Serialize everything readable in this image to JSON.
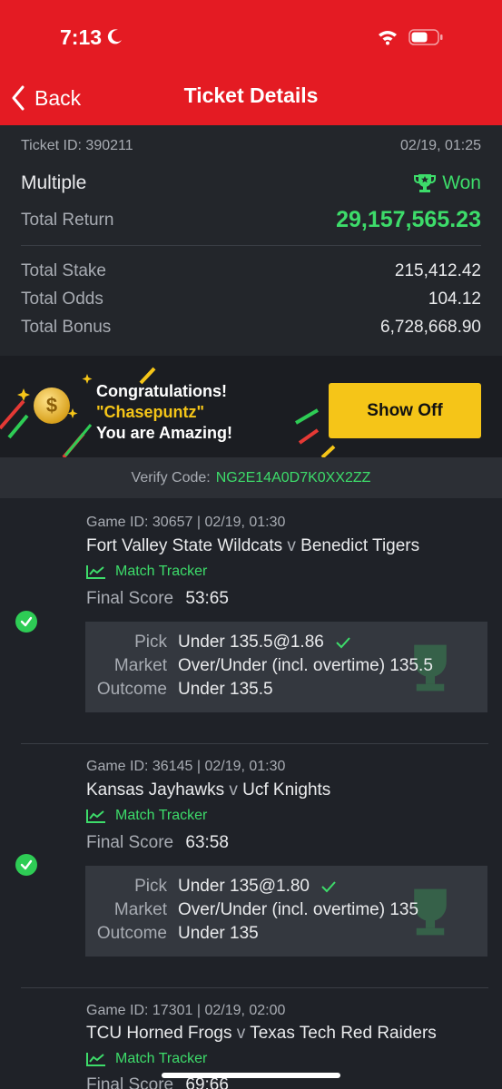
{
  "status": {
    "time": "7:13"
  },
  "header": {
    "back_label": "Back",
    "title": "Ticket Details"
  },
  "ticket": {
    "id_label": "Ticket ID: 390211",
    "datetime": "02/19, 01:25",
    "type": "Multiple",
    "status": "Won",
    "total_return_label": "Total Return",
    "total_return": "29,157,565.23",
    "total_stake_label": "Total Stake",
    "total_stake": "215,412.42",
    "total_odds_label": "Total Odds",
    "total_odds": "104.12",
    "total_bonus_label": "Total Bonus",
    "total_bonus": "6,728,668.90"
  },
  "banner": {
    "line1": "Congratulations!",
    "username": "\"Chasepuntz\"",
    "line3": "You are Amazing!",
    "button": "Show Off"
  },
  "verify": {
    "label": "Verify Code:",
    "code": "NG2E14A0D7K0XX2ZZ"
  },
  "selections": [
    {
      "game_id": "Game ID: 30657 | 02/19, 01:30",
      "home": "Fort Valley State Wildcats",
      "vs": "v",
      "away": "Benedict Tigers",
      "tracker": "Match Tracker",
      "final_label": "Final Score",
      "final_score": "53:65",
      "pick_label": "Pick",
      "pick": "Under 135.5@1.86",
      "market_label": "Market",
      "market": "Over/Under (incl. overtime) 135.5",
      "outcome_label": "Outcome",
      "outcome": "Under 135.5"
    },
    {
      "game_id": "Game ID: 36145 | 02/19, 01:30",
      "home": "Kansas Jayhawks",
      "vs": "v",
      "away": "Ucf Knights",
      "tracker": "Match Tracker",
      "final_label": "Final Score",
      "final_score": "63:58",
      "pick_label": "Pick",
      "pick": "Under 135@1.80",
      "market_label": "Market",
      "market": "Over/Under (incl. overtime) 135",
      "outcome_label": "Outcome",
      "outcome": "Under 135"
    },
    {
      "game_id": "Game ID: 17301 | 02/19, 02:00",
      "home": "TCU Horned Frogs",
      "vs": "v",
      "away": "Texas Tech Red Raiders",
      "tracker": "Match Tracker",
      "final_label": "Final Score",
      "final_score": "69:66"
    }
  ],
  "colors": {
    "header_red": "#e41b23",
    "won_green": "#3ddc6a",
    "showoff_yellow": "#f5c518",
    "background": "#1f2228"
  },
  "icons": [
    "moon-icon",
    "wifi-icon",
    "battery-icon",
    "chevron-left-icon",
    "trophy-icon",
    "coin-icon",
    "check-circle-icon",
    "chart-line-icon",
    "checkmark-icon"
  ]
}
